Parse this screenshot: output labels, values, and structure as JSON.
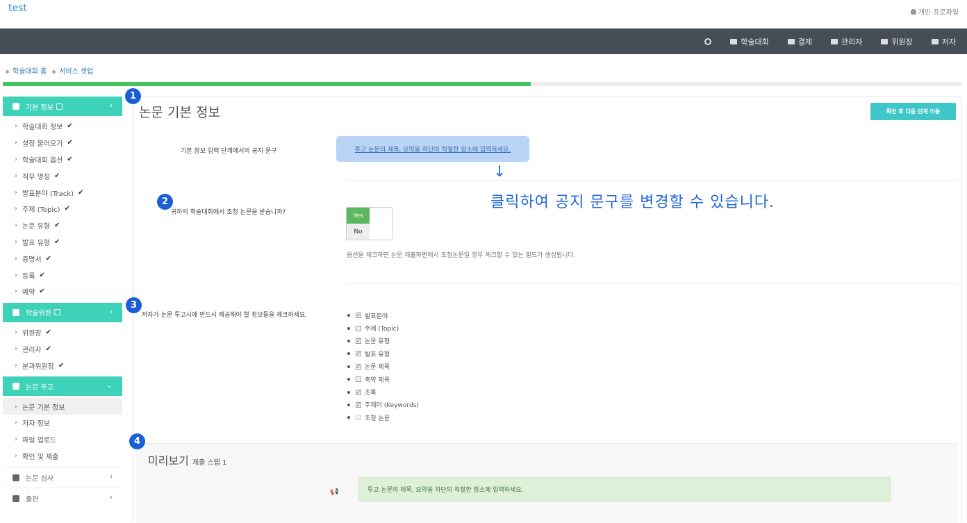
{
  "app": {
    "brand": "test",
    "profile": "개인 프로파일"
  },
  "nav": {
    "items": [
      "학술대회",
      "결제",
      "관리자",
      "위원장",
      "저자"
    ]
  },
  "breadcrumb": [
    "학술대회 홈",
    "서비스 셋업"
  ],
  "progress": {
    "fraction": 0.55
  },
  "sidebar": {
    "sections": [
      {
        "label": "기본 정보",
        "items": [
          "학술대회 정보",
          "설정 불러오기",
          "학술대회 옵션",
          "직무 명칭",
          "발표분야 (Track)",
          "주제 (Topic)",
          "논문 유형",
          "발표 유형",
          "증명서",
          "등록",
          "예약"
        ]
      },
      {
        "label": "학술위원",
        "items": [
          "위원장",
          "관리자",
          "분과위원장"
        ]
      },
      {
        "label": "논문 투고",
        "items": [
          "논문 기본 정보",
          "저자 정보",
          "파일 업로드",
          "확인 및 제출"
        ]
      },
      {
        "label": "논문 심사"
      },
      {
        "label": "출판"
      }
    ]
  },
  "main": {
    "title": "논문 기본 정보",
    "next_button": "확인 후 다음 단계 이동",
    "notice_label": "기본 정보 입력 단계에서의 공지 문구",
    "notice_text": "투고 논문의 제목, 요약을 하단의 적절한 장소에 입력하세요.",
    "annotation": "클릭하여 공지 문구를 변경할 수 있습니다.",
    "invited_question": "귀하의 학술대회에서 초청 논문을 받습니까?",
    "yes": "Yes",
    "no": "No",
    "invited_hint": "옵션을 체크하면 논문 제출화면에서 초청논문일 경우 체크할 수 있는 필드가 생성됩니다.",
    "fields_label": "저자가 논문 투고시에 반드시 제공해야 할 정보들을 체크하세요.",
    "fields": [
      {
        "label": "발표분야",
        "checked": true
      },
      {
        "label": "주제 (Topic)",
        "checked": false
      },
      {
        "label": "논문 유형",
        "checked": true
      },
      {
        "label": "발표 유형",
        "checked": true
      },
      {
        "label": "논문 제목",
        "checked": true
      },
      {
        "label": "축약 제목",
        "checked": false
      },
      {
        "label": "초록",
        "checked": true
      },
      {
        "label": "주제어 (Keywords)",
        "checked": true
      },
      {
        "label": "초청 논문",
        "checked": false
      }
    ],
    "preview_title": "미리보기",
    "preview_sub": "제출 스텝 1",
    "preview_notice": "투고 논문의 제목, 요약을 하단의 적절한 장소에 입력하세요."
  },
  "badges": [
    "1",
    "2",
    "3",
    "4"
  ],
  "colors": {
    "accent": "#3ed2b9",
    "navbar": "#454d57",
    "progress": "#45c55b",
    "annotation": "#2367d9"
  }
}
